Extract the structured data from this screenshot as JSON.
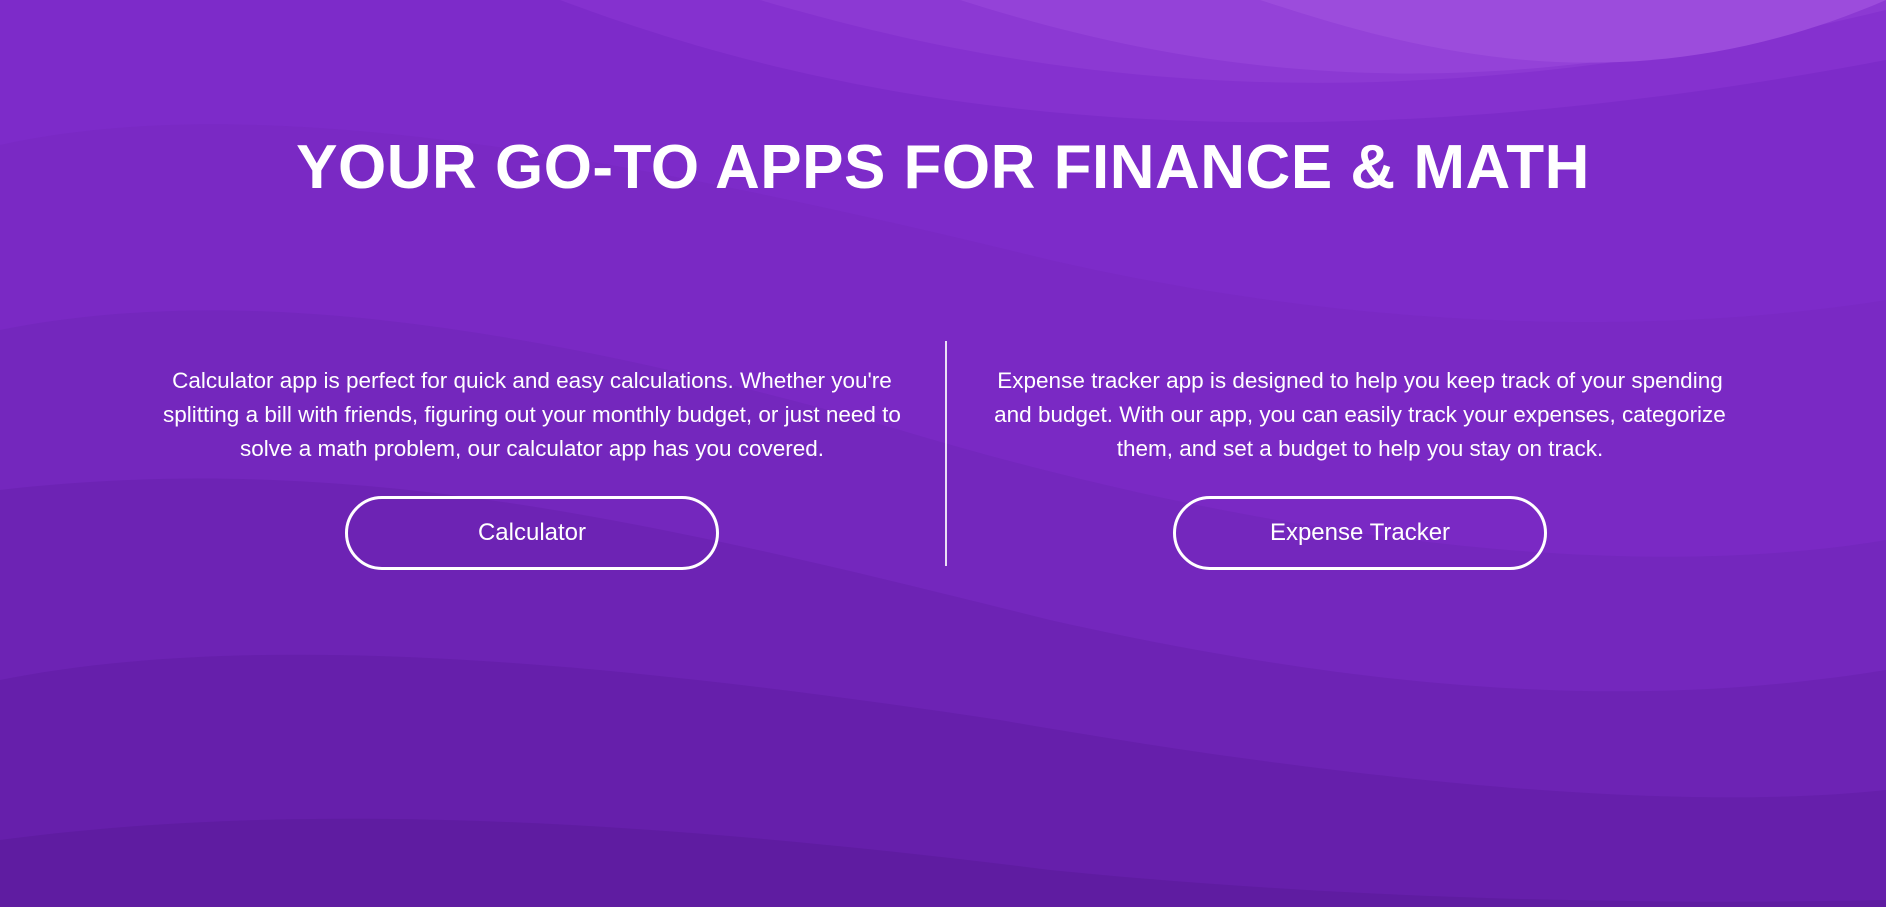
{
  "hero": {
    "title": "YOUR GO-TO APPS FOR FINANCE & MATH"
  },
  "apps": [
    {
      "description": "Calculator app is perfect for quick and easy calculations. Whether you're splitting a bill with friends, figuring out your monthly budget, or just need to solve a math problem, our calculator app has you covered.",
      "button_label": "Calculator"
    },
    {
      "description": "Expense tracker app is designed to help you keep track of your spending and budget. With our app, you can easily track your expenses, categorize them, and set a budget to help you stay on track.",
      "button_label": "Expense Tracker"
    }
  ],
  "colors": {
    "background_top": "#9b4fdc",
    "background_bottom": "#5e1b9c",
    "text": "#ffffff"
  }
}
